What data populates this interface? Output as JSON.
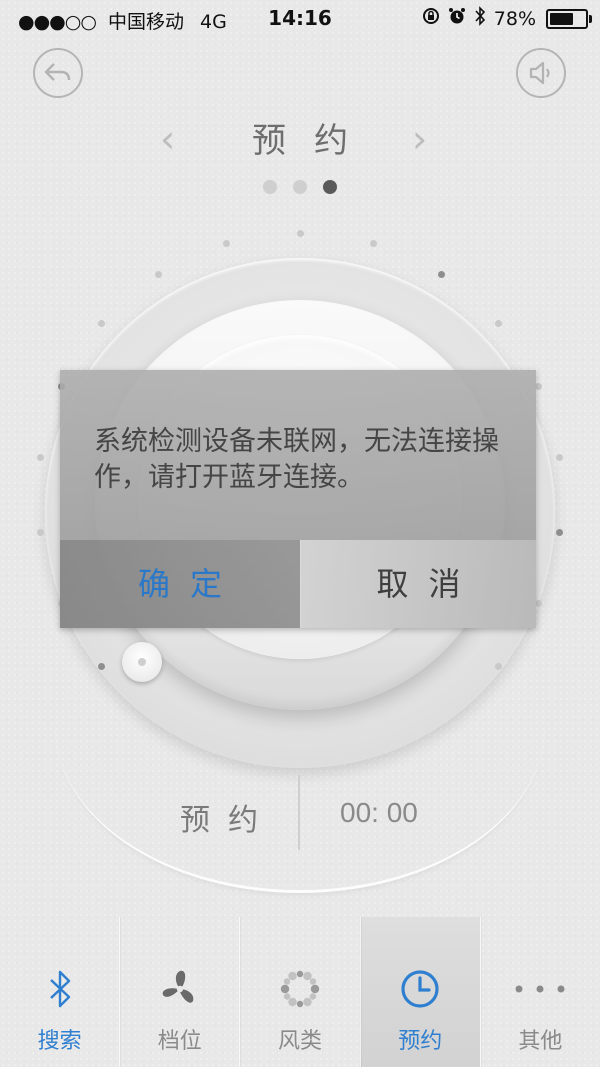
{
  "status_bar": {
    "signal": "●●●○○",
    "carrier": "中国移动",
    "network": "4G",
    "time": "14:16",
    "battery_percent": "78%",
    "battery_level": 0.78
  },
  "header": {
    "title": "预约",
    "page_count": 3,
    "active_page": 3
  },
  "dialog": {
    "message": "系统检测设备未联网，无法连接操作，请打开蓝牙连接。",
    "confirm_label": "确定",
    "cancel_label": "取消"
  },
  "reservation": {
    "label": "预约",
    "value": "00: 00"
  },
  "bottom_nav": {
    "items": [
      {
        "label": "搜索",
        "icon": "bluetooth-icon"
      },
      {
        "label": "档位",
        "icon": "fan-icon"
      },
      {
        "label": "风类",
        "icon": "wind-type-icon"
      },
      {
        "label": "预约",
        "icon": "clock-icon",
        "active": true
      },
      {
        "label": "其他",
        "icon": "more-icon"
      }
    ]
  },
  "colors": {
    "accent_blue": "#2f7fd0",
    "background": "#e8e8e8"
  }
}
